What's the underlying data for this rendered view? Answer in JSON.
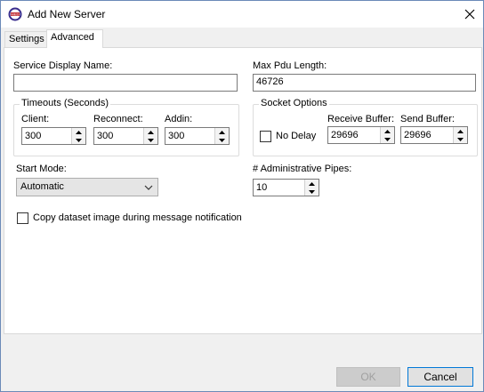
{
  "window": {
    "title": "Add New Server",
    "app_icon": "monitor-logo-icon",
    "close_icon": "close-icon"
  },
  "tabs": [
    {
      "label": "Settings",
      "active": false
    },
    {
      "label": "Advanced",
      "active": true
    }
  ],
  "service_display_name": {
    "label": "Service Display Name:",
    "value": ""
  },
  "max_pdu_length": {
    "label": "Max Pdu Length:",
    "value": "46726"
  },
  "timeouts": {
    "title": "Timeouts (Seconds)",
    "client": {
      "label": "Client:",
      "value": "300"
    },
    "reconnect": {
      "label": "Reconnect:",
      "value": "300"
    },
    "addin": {
      "label": "Addin:",
      "value": "300"
    }
  },
  "socket_options": {
    "title": "Socket Options",
    "no_delay": {
      "label": "No Delay",
      "checked": false
    },
    "receive_buffer": {
      "label": "Receive Buffer:",
      "value": "29696"
    },
    "send_buffer": {
      "label": "Send Buffer:",
      "value": "29696"
    }
  },
  "start_mode": {
    "label": "Start Mode:",
    "value": "Automatic"
  },
  "admin_pipes": {
    "label": "# Administrative Pipes:",
    "value": "10"
  },
  "copy_dataset": {
    "label": "Copy dataset image during message notification",
    "checked": false
  },
  "buttons": {
    "ok": "OK",
    "cancel": "Cancel"
  },
  "colors": {
    "accent": "#0078d7",
    "window_bg": "#f0f0f0",
    "panel_bg": "#ffffff"
  }
}
